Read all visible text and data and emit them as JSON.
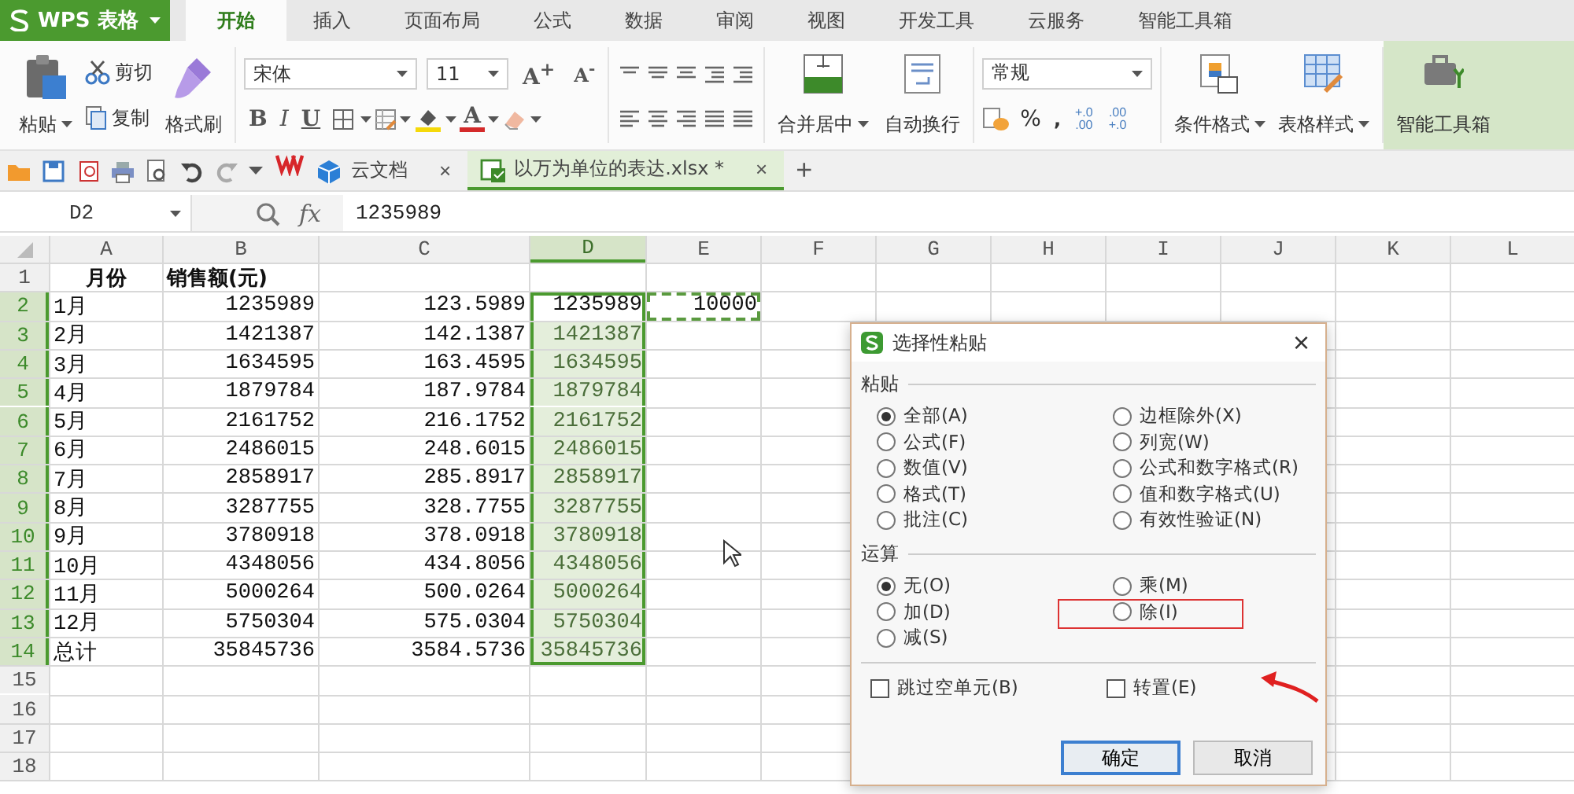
{
  "app": {
    "name": "WPS 表格"
  },
  "menu_tabs": [
    {
      "label": "开始",
      "selected": true
    },
    {
      "label": "插入",
      "selected": false
    },
    {
      "label": "页面布局",
      "selected": false
    },
    {
      "label": "公式",
      "selected": false
    },
    {
      "label": "数据",
      "selected": false
    },
    {
      "label": "审阅",
      "selected": false
    },
    {
      "label": "视图",
      "selected": false
    },
    {
      "label": "开发工具",
      "selected": false
    },
    {
      "label": "云服务",
      "selected": false
    },
    {
      "label": "智能工具箱",
      "selected": false
    }
  ],
  "ribbon": {
    "paste": "粘贴",
    "cut": "剪切",
    "copy": "复制",
    "format_painter": "格式刷",
    "font_name": "宋体",
    "font_size": "11",
    "grow_font": "A$^{+}$",
    "shrink_font": "A$^{-}$",
    "bold": "B",
    "italic": "I",
    "underline": "U",
    "font_color": "A",
    "merge": "合并居中",
    "wrap": "自动换行",
    "number_format": "常规",
    "percent": "%",
    "thousands": ",",
    "increase_decimal": "+.0\n.00",
    "decrease_decimal": ".00\n+.0",
    "conditional_format": "条件格式",
    "table_style": "表格样式",
    "toolbox": "智能工具箱"
  },
  "doc_tabs": [
    {
      "label": "云文档",
      "kind": "cloud",
      "selected": false,
      "close": "×"
    },
    {
      "label": "以万为单位的表达.xlsx *",
      "kind": "sheet",
      "selected": true,
      "close": "×"
    }
  ],
  "new_tab": "+",
  "formula_bar": {
    "name_box": "D2",
    "fx": "fx",
    "value": "1235989"
  },
  "sheet": {
    "columns": [
      {
        "label": "A",
        "selected": false
      },
      {
        "label": "B",
        "selected": false
      },
      {
        "label": "C",
        "selected": false
      },
      {
        "label": "D",
        "selected": true
      },
      {
        "label": "E",
        "selected": false
      },
      {
        "label": "F",
        "selected": false
      },
      {
        "label": "G",
        "selected": false
      },
      {
        "label": "H",
        "selected": false
      },
      {
        "label": "I",
        "selected": false
      },
      {
        "label": "J",
        "selected": false
      },
      {
        "label": "K",
        "selected": false
      },
      {
        "label": "L",
        "selected": false
      }
    ],
    "rows": [
      {
        "number": "1",
        "kind": "header",
        "selected": false,
        "cells": [
          {
            "text": "月份"
          },
          {
            "text": "销售额(元)"
          }
        ]
      },
      {
        "number": "2",
        "kind": "data",
        "selected": true,
        "cells": [
          {
            "text": "1月"
          },
          {
            "text": "1235989"
          },
          {
            "text": "123.5989"
          },
          {
            "text": "1235989",
            "active": true
          },
          {
            "text": "10000",
            "copied": true
          }
        ]
      },
      {
        "number": "3",
        "kind": "data",
        "selected": true,
        "cells": [
          {
            "text": "2月"
          },
          {
            "text": "1421387"
          },
          {
            "text": "142.1387"
          },
          {
            "text": "1421387",
            "active": false
          }
        ]
      },
      {
        "number": "4",
        "kind": "data",
        "selected": true,
        "cells": [
          {
            "text": "3月"
          },
          {
            "text": "1634595"
          },
          {
            "text": "163.4595"
          },
          {
            "text": "1634595",
            "active": false
          }
        ]
      },
      {
        "number": "5",
        "kind": "data",
        "selected": true,
        "cells": [
          {
            "text": "4月"
          },
          {
            "text": "1879784"
          },
          {
            "text": "187.9784"
          },
          {
            "text": "1879784",
            "active": false
          }
        ]
      },
      {
        "number": "6",
        "kind": "data",
        "selected": true,
        "cells": [
          {
            "text": "5月"
          },
          {
            "text": "2161752"
          },
          {
            "text": "216.1752"
          },
          {
            "text": "2161752",
            "active": false
          }
        ]
      },
      {
        "number": "7",
        "kind": "data",
        "selected": true,
        "cells": [
          {
            "text": "6月"
          },
          {
            "text": "2486015"
          },
          {
            "text": "248.6015"
          },
          {
            "text": "2486015",
            "active": false
          }
        ]
      },
      {
        "number": "8",
        "kind": "data",
        "selected": true,
        "cells": [
          {
            "text": "7月"
          },
          {
            "text": "2858917"
          },
          {
            "text": "285.8917"
          },
          {
            "text": "2858917",
            "active": false
          }
        ]
      },
      {
        "number": "9",
        "kind": "data",
        "selected": true,
        "cells": [
          {
            "text": "8月"
          },
          {
            "text": "3287755"
          },
          {
            "text": "328.7755"
          },
          {
            "text": "3287755",
            "active": false
          }
        ]
      },
      {
        "number": "10",
        "kind": "data",
        "selected": true,
        "cells": [
          {
            "text": "9月"
          },
          {
            "text": "3780918"
          },
          {
            "text": "378.0918"
          },
          {
            "text": "3780918",
            "active": false
          }
        ]
      },
      {
        "number": "11",
        "kind": "data",
        "selected": true,
        "cells": [
          {
            "text": "10月"
          },
          {
            "text": "4348056"
          },
          {
            "text": "434.8056"
          },
          {
            "text": "4348056",
            "active": false
          }
        ]
      },
      {
        "number": "12",
        "kind": "data",
        "selected": true,
        "cells": [
          {
            "text": "11月"
          },
          {
            "text": "5000264"
          },
          {
            "text": "500.0264"
          },
          {
            "text": "5000264",
            "active": false
          }
        ]
      },
      {
        "number": "13",
        "kind": "data",
        "selected": true,
        "cells": [
          {
            "text": "12月"
          },
          {
            "text": "5750304"
          },
          {
            "text": "575.0304"
          },
          {
            "text": "5750304",
            "active": false
          }
        ]
      },
      {
        "number": "14",
        "kind": "data",
        "selected": true,
        "cells": [
          {
            "text": "总计"
          },
          {
            "text": "35845736"
          },
          {
            "text": "3584.5736"
          },
          {
            "text": "35845736",
            "active": false
          }
        ]
      },
      {
        "number": "15",
        "selected": false
      },
      {
        "number": "16",
        "selected": false
      },
      {
        "number": "17",
        "selected": false
      },
      {
        "number": "18",
        "selected": false
      }
    ]
  },
  "dialog": {
    "title": "选择性粘贴",
    "close": "×",
    "paste_section": "粘贴",
    "paste_options": [
      {
        "label": "全部(A)",
        "selected": true
      },
      {
        "label": "边框除外(X)",
        "selected": false
      },
      {
        "label": "公式(F)",
        "selected": false
      },
      {
        "label": "列宽(W)",
        "selected": false
      },
      {
        "label": "数值(V)",
        "selected": false
      },
      {
        "label": "公式和数字格式(R)",
        "selected": false
      },
      {
        "label": "格式(T)",
        "selected": false
      },
      {
        "label": "值和数字格式(U)",
        "selected": false
      },
      {
        "label": "批注(C)",
        "selected": false
      },
      {
        "label": "有效性验证(N)",
        "selected": false
      }
    ],
    "operation_section": "运算",
    "operations": [
      {
        "label": "无(O)",
        "selected": true,
        "highlighted": false
      },
      {
        "label": "乘(M)",
        "selected": false,
        "highlighted": false
      },
      {
        "label": "加(D)",
        "selected": false,
        "highlighted": false
      },
      {
        "label": "除(I)",
        "selected": false,
        "highlighted": true
      },
      {
        "label": "减(S)",
        "selected": false,
        "highlighted": false
      }
    ],
    "checkboxes": [
      {
        "label": "跳过空单元(B)",
        "checked": false
      },
      {
        "label": "转置(E)",
        "checked": false
      }
    ],
    "buttons": [
      {
        "label": "确定",
        "kind": "default"
      },
      {
        "label": "取消",
        "kind": "normal"
      }
    ]
  }
}
